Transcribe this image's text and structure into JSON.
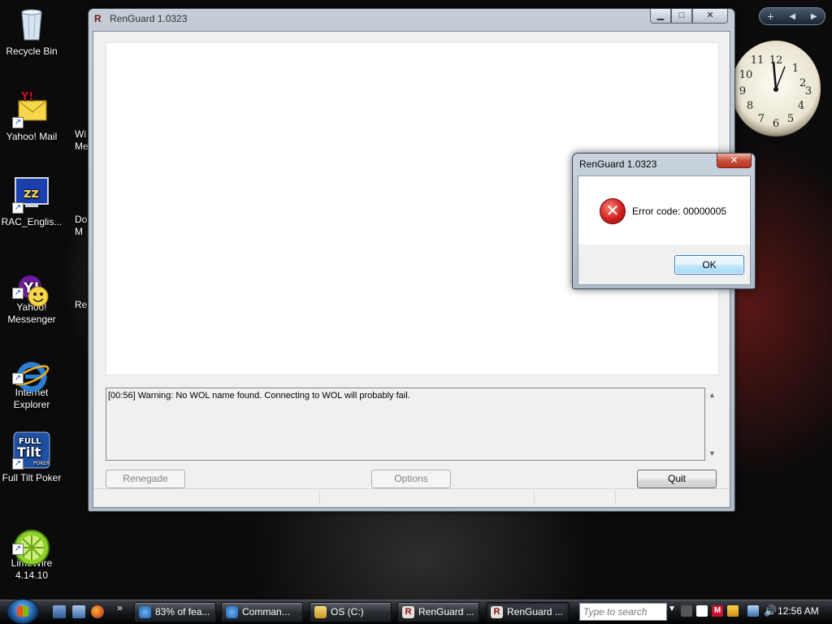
{
  "desktop": {
    "icons": [
      {
        "label": "Recycle Bin",
        "icon": "recycle-bin-icon"
      },
      {
        "label": "Yahoo! Mail",
        "icon": "yahoo-mail-icon"
      },
      {
        "label": "RAC_Englis...",
        "icon": "rac-icon"
      },
      {
        "label": "Yahoo!\nMessenger",
        "icon": "yahoo-messenger-icon"
      },
      {
        "label": "Internet\nExplorer",
        "icon": "internet-explorer-icon"
      },
      {
        "label": "Full Tilt Poker",
        "icon": "full-tilt-poker-icon"
      },
      {
        "label": "LimeWire\n4.14.10",
        "icon": "limewire-icon"
      }
    ],
    "partial_labels": [
      "Wi\nMed",
      "Do\nM",
      "Re"
    ]
  },
  "main_window": {
    "title": "RenGuard 1.0323",
    "log_text": "[00:56] Warning: No WOL name found. Connecting to WOL will probably fail.",
    "buttons": {
      "renegade": "Renegade",
      "options": "Options",
      "quit": "Quit"
    }
  },
  "error_dialog": {
    "title": "RenGuard 1.0323",
    "message": "Error code: 00000005",
    "ok_label": "OK"
  },
  "taskbar": {
    "tasks": [
      {
        "label": "83% of fea...",
        "icon": "internet-explorer-icon"
      },
      {
        "label": "Comman...",
        "icon": "internet-explorer-icon"
      },
      {
        "label": "OS (C:)",
        "icon": "folder-icon"
      },
      {
        "label": "RenGuard ...",
        "icon": "renguard-icon"
      },
      {
        "label": "RenGuard ...",
        "icon": "renguard-icon",
        "active": true
      }
    ],
    "search_placeholder": "Type to search",
    "time": "12:56 AM"
  },
  "colors": {
    "accent_blue": "#2d6fb6",
    "error_red": "#d21e1e"
  }
}
